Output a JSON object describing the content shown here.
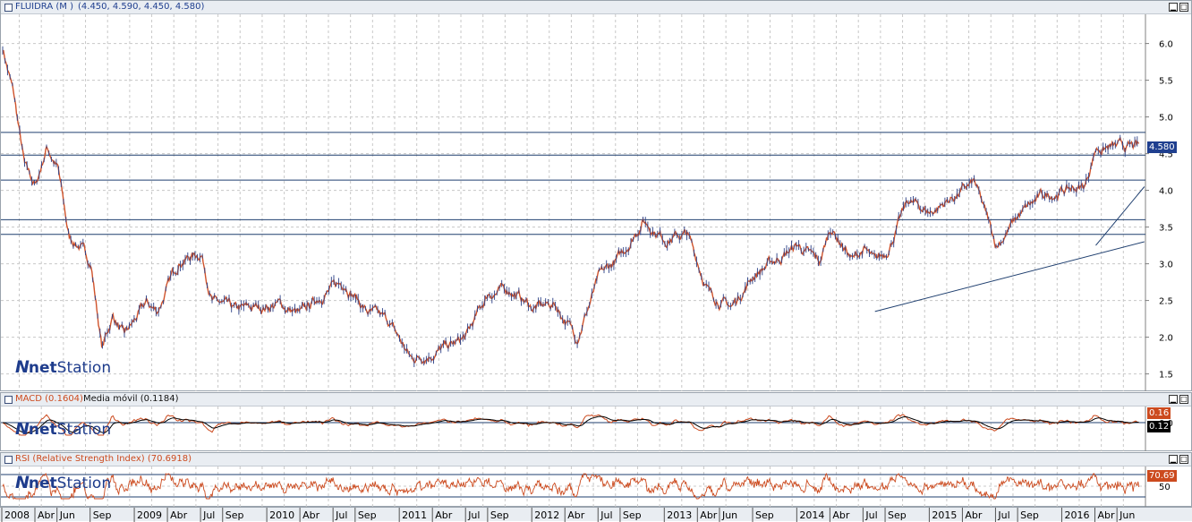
{
  "main_panel": {
    "title": "FLUIDRA (M )",
    "ohlc": "(4.450, 4.590, 4.450, 4.580)",
    "last_price_label": "4.580",
    "last_price_color": "#1f3f8f",
    "brand_n": "N",
    "brand_net": "net",
    "brand_station": "Station"
  },
  "macd_panel": {
    "title": "MACD (0.1604)",
    "signal_title": "Media móvil (0.1184)",
    "macd_badge": "0.16",
    "signal_badge": "0.12",
    "macd_color": "#cc4a1e",
    "signal_color": "#000000"
  },
  "rsi_panel": {
    "title": "RSI (Relative Strength Index) (70.6918)",
    "rsi_badge": "70.69",
    "level_label": "50",
    "rsi_color": "#cc4a1e"
  },
  "time_axis": {
    "labels": [
      "2008",
      "Abr",
      "Jun",
      "Sep",
      "2009",
      "Abr",
      "Jul",
      "Sep",
      "2010",
      "Abr",
      "Jul",
      "Sep",
      "2011",
      "Abr",
      "Jul",
      "Sep",
      "2012",
      "Abr",
      "Jul",
      "Sep",
      "2013",
      "Abr",
      "Jun",
      "Sep",
      "2014",
      "Abr",
      "Jul",
      "Sep",
      "2015",
      "Abr",
      "Jul",
      "Sep",
      "2016",
      "Abr",
      "Jun"
    ]
  },
  "chart_data": {
    "type": "line",
    "title": "FLUIDRA (M )",
    "series": [
      {
        "name": "FLUIDRA (M )",
        "x": [
          "2008-01",
          "2008-02",
          "2008-03",
          "2008-04",
          "2008-05",
          "2008-06",
          "2008-07",
          "2008-08",
          "2008-09",
          "2008-10",
          "2008-11",
          "2008-12",
          "2009-02",
          "2009-03",
          "2009-05",
          "2009-07",
          "2009-08",
          "2009-10",
          "2009-12",
          "2010-02",
          "2010-04",
          "2010-06",
          "2010-08",
          "2010-10",
          "2010-12",
          "2011-02",
          "2011-04",
          "2011-06",
          "2011-07",
          "2011-09",
          "2011-11",
          "2012-01",
          "2012-03",
          "2012-05",
          "2012-07",
          "2012-09",
          "2012-11",
          "2013-01",
          "2013-03",
          "2013-05",
          "2013-07",
          "2013-09",
          "2013-11",
          "2014-01",
          "2014-03",
          "2014-04",
          "2014-06",
          "2014-07",
          "2014-08",
          "2014-09",
          "2014-11",
          "2015-01",
          "2015-03",
          "2015-05",
          "2015-07",
          "2015-09",
          "2015-11",
          "2016-01",
          "2016-03",
          "2016-04",
          "2016-05",
          "2016-06",
          "2016-07",
          "2016-08"
        ],
        "values": [
          5.95,
          5.3,
          4.3,
          4.05,
          4.6,
          4.3,
          3.35,
          3.25,
          3.0,
          1.85,
          2.3,
          2.0,
          2.45,
          2.35,
          3.05,
          3.15,
          2.5,
          2.35,
          2.4,
          2.45,
          2.3,
          2.6,
          2.75,
          2.35,
          2.2,
          1.7,
          1.8,
          1.9,
          2.0,
          2.6,
          2.65,
          2.4,
          2.45,
          2.0,
          2.8,
          3.1,
          3.6,
          3.35,
          3.4,
          2.6,
          2.4,
          2.85,
          3.05,
          3.25,
          3.0,
          3.5,
          3.05,
          3.2,
          3.0,
          3.15,
          3.85,
          3.7,
          3.9,
          4.1,
          3.25,
          3.65,
          3.9,
          4.0,
          4.05,
          4.58,
          4.58,
          4.58,
          4.58,
          4.58
        ]
      }
    ],
    "y_ticks": [
      "6.0",
      "5.5",
      "5.0",
      "4.5",
      "4.0",
      "3.5",
      "3.0",
      "2.5",
      "2.0",
      "1.5"
    ],
    "ylim": [
      1.3,
      6.3
    ],
    "horizontal_levels": [
      4.79,
      4.48,
      4.14,
      3.6,
      3.4
    ],
    "trendlines": [
      {
        "from": [
          "2014-08",
          2.35
        ],
        "to": [
          "2016-08",
          3.3
        ]
      },
      {
        "from": [
          "2016-04",
          3.25
        ],
        "to": [
          "2016-08",
          4.05
        ]
      }
    ],
    "macd_ticks": [
      "0.0"
    ],
    "rsi_ticks": [
      "50"
    ],
    "grid": true,
    "grid_style": "dashed"
  }
}
